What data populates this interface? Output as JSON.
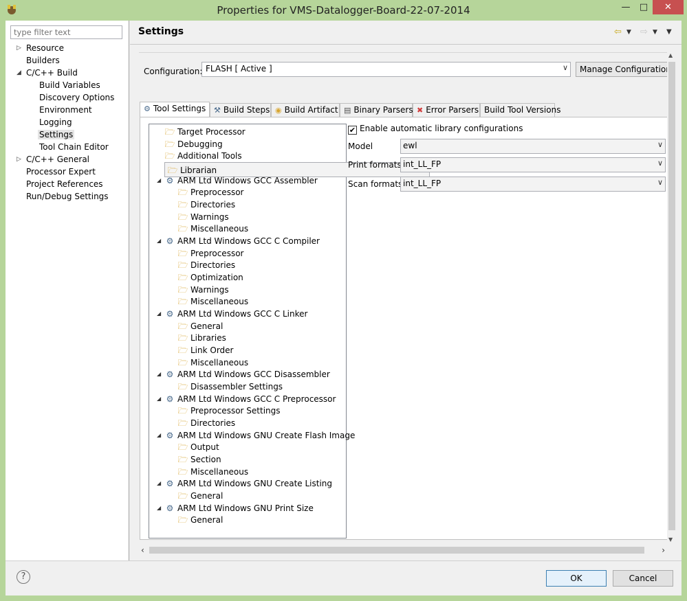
{
  "window": {
    "title": "Properties for VMS-Datalogger-Board-22-07-2014",
    "minimize_glyph": "—",
    "maximize_glyph": "□",
    "close_glyph": "✕"
  },
  "filter": {
    "placeholder": "type filter text"
  },
  "nav": {
    "items": [
      {
        "label": "Resource"
      },
      {
        "label": "Builders"
      },
      {
        "label": "C/C++ Build"
      },
      {
        "label": "Build Variables"
      },
      {
        "label": "Discovery Options"
      },
      {
        "label": "Environment"
      },
      {
        "label": "Logging"
      },
      {
        "label": "Settings"
      },
      {
        "label": "Tool Chain Editor"
      },
      {
        "label": "C/C++ General"
      },
      {
        "label": "Processor Expert"
      },
      {
        "label": "Project References"
      },
      {
        "label": "Run/Debug Settings"
      }
    ]
  },
  "page": {
    "title": "Settings"
  },
  "configuration": {
    "label": "Configuration:",
    "value": "FLASH  [ Active ]",
    "manage_label": "Manage Configurations..."
  },
  "tabs": [
    {
      "label": "Tool Settings",
      "icon": "tool-settings-icon"
    },
    {
      "label": "Build Steps",
      "icon": "build-steps-icon"
    },
    {
      "label": "Build Artifact",
      "icon": "build-artifact-icon"
    },
    {
      "label": "Binary Parsers",
      "icon": "binary-parsers-icon"
    },
    {
      "label": "Error Parsers",
      "icon": "error-parsers-icon"
    },
    {
      "label": "Build Tool Versions",
      "icon": ""
    }
  ],
  "tree": {
    "items": [
      {
        "label": "Target Processor"
      },
      {
        "label": "Debugging"
      },
      {
        "label": "Additional Tools"
      },
      {
        "label": "Librarian"
      },
      {
        "label": "ARM Ltd Windows GCC Assembler"
      },
      {
        "label": "Preprocessor"
      },
      {
        "label": "Directories"
      },
      {
        "label": "Warnings"
      },
      {
        "label": "Miscellaneous"
      },
      {
        "label": "ARM Ltd Windows GCC C Compiler"
      },
      {
        "label": "Preprocessor"
      },
      {
        "label": "Directories"
      },
      {
        "label": "Optimization"
      },
      {
        "label": "Warnings"
      },
      {
        "label": "Miscellaneous"
      },
      {
        "label": "ARM Ltd Windows GCC C Linker"
      },
      {
        "label": "General"
      },
      {
        "label": "Libraries"
      },
      {
        "label": "Link Order"
      },
      {
        "label": "Miscellaneous"
      },
      {
        "label": "ARM Ltd Windows GCC Disassembler"
      },
      {
        "label": "Disassembler Settings"
      },
      {
        "label": "ARM Ltd Windows GCC C Preprocessor"
      },
      {
        "label": "Preprocessor Settings"
      },
      {
        "label": "Directories"
      },
      {
        "label": "ARM Ltd Windows GNU Create Flash Image"
      },
      {
        "label": "Output"
      },
      {
        "label": "Section"
      },
      {
        "label": "Miscellaneous"
      },
      {
        "label": "ARM Ltd Windows GNU Create Listing"
      },
      {
        "label": "General"
      },
      {
        "label": "ARM Ltd Windows GNU Print Size"
      },
      {
        "label": "General"
      }
    ]
  },
  "options": {
    "auto_lib_label": "Enable automatic library configurations",
    "auto_lib_checked": true,
    "model_label": "Model",
    "model_value": "ewl",
    "print_label": "Print formats",
    "print_value": "int_LL_FP",
    "scan_label": "Scan formats",
    "scan_value": "int_LL_FP"
  },
  "footer": {
    "help": "?",
    "ok": "OK",
    "cancel": "Cancel"
  },
  "colors": {
    "frame": "#b6d59a",
    "close_button": "#c75050",
    "ok_border": "#3c7fb1",
    "folder": "#d8a631",
    "tool": "#496a8c"
  }
}
